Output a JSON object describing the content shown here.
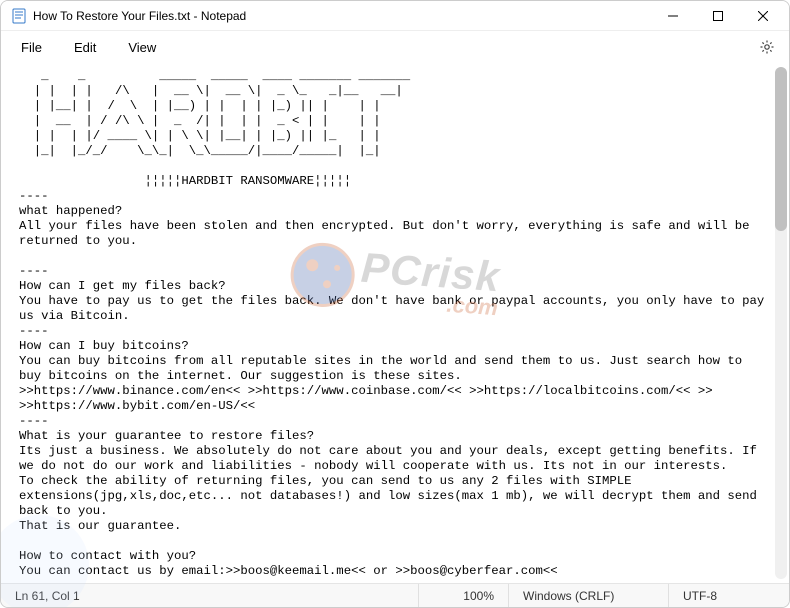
{
  "window": {
    "title": "How To Restore Your Files.txt - Notepad"
  },
  "menu": {
    "file": "File",
    "edit": "Edit",
    "view": "View"
  },
  "note_content": "   _    _          _____  _____  ____ _______ _______\n  | |  | |   /\\   |  __ \\|  __ \\|  _ \\_   _|__   __|\n  | |__| |  /  \\  | |__) | |  | | |_) || |    | |\n  |  __  | / /\\ \\ |  _  /| |  | |  _ < | |    | |\n  | |  | |/ ____ \\| | \\ \\| |__| | |_) || |_   | |\n  |_|  |_/_/    \\_\\_|  \\_\\_____/|____/_____|  |_|\n\n                 ¦¦¦¦¦HARDBIT RANSOMWARE¦¦¦¦¦\n----\nwhat happened?\nAll your files have been stolen and then encrypted. But don't worry, everything is safe and will be returned to you.\n\n----\nHow can I get my files back?\nYou have to pay us to get the files back. We don't have bank or paypal accounts, you only have to pay us via Bitcoin.\n----\nHow can I buy bitcoins?\nYou can buy bitcoins from all reputable sites in the world and send them to us. Just search how to buy bitcoins on the internet. Our suggestion is these sites.\n>>https://www.binance.com/en<< >>https://www.coinbase.com/<< >>https://localbitcoins.com/<< >>\n>>https://www.bybit.com/en-US/<<\n----\nWhat is your guarantee to restore files?\nIts just a business. We absolutely do not care about you and your deals, except getting benefits. If we do not do our work and liabilities - nobody will cooperate with us. Its not in our interests.\nTo check the ability of returning files, you can send to us any 2 files with SIMPLE extensions(jpg,xls,doc,etc... not databases!) and low sizes(max 1 mb), we will decrypt them and send back to you.\nThat is our guarantee.\n\nHow to contact with you?\nYou can contact us by email:>>boos@keemail.me<< or >>boos@cyberfear.com<<",
  "status": {
    "position": "Ln 61, Col 1",
    "zoom": "100%",
    "line_ending": "Windows (CRLF)",
    "encoding": "UTF-8"
  },
  "watermark": {
    "text": "PCrisk",
    "suffix": ".com"
  }
}
